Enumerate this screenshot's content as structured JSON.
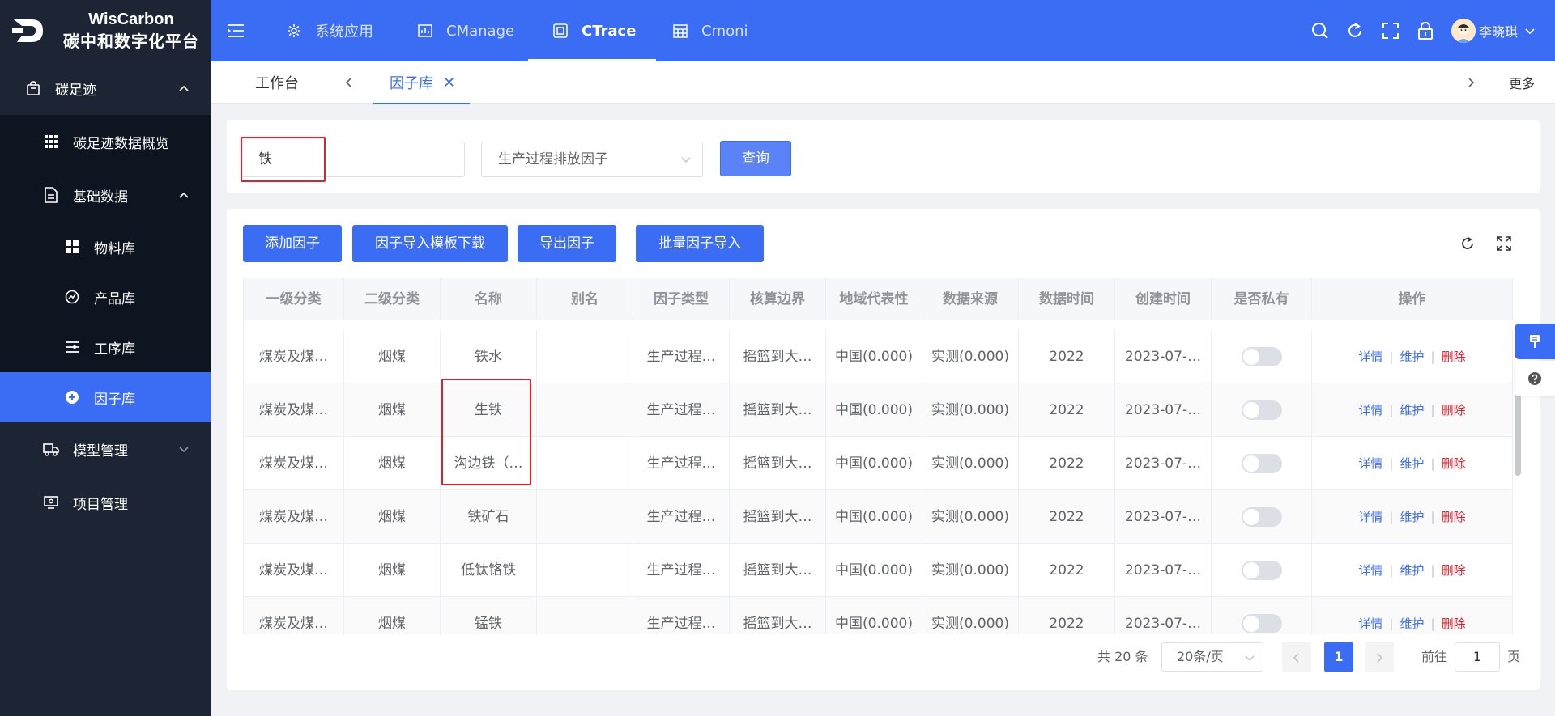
{
  "brand": {
    "name": "WisCarbon",
    "subtitle": "碳中和数字化平台"
  },
  "sidebar": {
    "group_footprint": "碳足迹",
    "item_overview": "碳足迹数据概览",
    "group_basic": "基础数据",
    "item_material": "物料库",
    "item_product": "产品库",
    "item_process": "工序库",
    "item_factor": "因子库",
    "group_model": "模型管理",
    "group_project": "项目管理"
  },
  "header": {
    "tabs": [
      "系统应用",
      "CManage",
      "CTrace",
      "Cmoni"
    ],
    "active_tab": "CTrace",
    "user_name": "李晓琪"
  },
  "tabsbar": {
    "workbench": "工作台",
    "current": "因子库",
    "more": "更多"
  },
  "search": {
    "keyword": "铁",
    "factor_type": "生产过程排放因子",
    "query_label": "查询"
  },
  "toolbar": {
    "add_label": "添加因子",
    "template_label": "因子导入模板下载",
    "export_label": "导出因子",
    "batch_label": "批量因子导入"
  },
  "table": {
    "headers": [
      "一级分类",
      "二级分类",
      "名称",
      "别名",
      "因子类型",
      "核算边界",
      "地域代表性",
      "数据来源",
      "数据时间",
      "创建时间",
      "是否私有",
      "操作"
    ],
    "rows": [
      [
        "煤炭及煤…",
        "烟煤",
        "铁水",
        "",
        "生产过程…",
        "摇篮到大…",
        "中国(0.000)",
        "实测(0.000)",
        "2022",
        "2023-07-…"
      ],
      [
        "煤炭及煤…",
        "烟煤",
        "生铁",
        "",
        "生产过程…",
        "摇篮到大…",
        "中国(0.000)",
        "实测(0.000)",
        "2022",
        "2023-07-…"
      ],
      [
        "煤炭及煤…",
        "烟煤",
        "沟边铁（…",
        "",
        "生产过程…",
        "摇篮到大…",
        "中国(0.000)",
        "实测(0.000)",
        "2022",
        "2023-07-…"
      ],
      [
        "煤炭及煤…",
        "烟煤",
        "铁矿石",
        "",
        "生产过程…",
        "摇篮到大…",
        "中国(0.000)",
        "实测(0.000)",
        "2022",
        "2023-07-…"
      ],
      [
        "煤炭及煤…",
        "烟煤",
        "低钛铬铁",
        "",
        "生产过程…",
        "摇篮到大…",
        "中国(0.000)",
        "实测(0.000)",
        "2022",
        "2023-07-…"
      ],
      [
        "煤炭及煤…",
        "烟煤",
        "锰铁",
        "",
        "生产过程…",
        "摇篮到大…",
        "中国(0.000)",
        "实测(0.000)",
        "2022",
        "2023-07-…"
      ]
    ],
    "ops": {
      "detail": "详情",
      "maintain": "维护",
      "delete": "删除"
    }
  },
  "pagination": {
    "total": "共 20 条",
    "page_size": "20条/页",
    "current_page": "1",
    "goto_label": "前往",
    "goto_value": "1",
    "page_unit": "页"
  },
  "colors": {
    "primary": "#3b6cf4",
    "sidebar": "#1d2534",
    "danger": "#e0202a"
  }
}
